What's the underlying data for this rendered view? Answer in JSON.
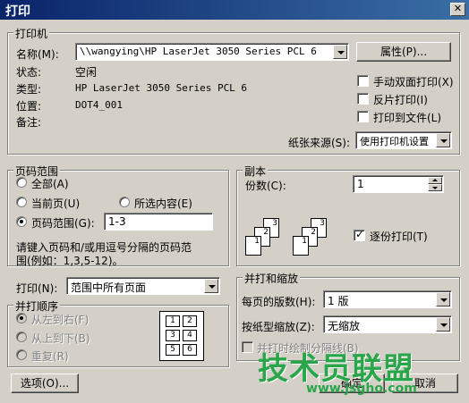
{
  "window": {
    "title": "打印",
    "close_glyph": "✕"
  },
  "printer": {
    "group_label": "打印机",
    "name_label": "名称(M):",
    "name_value": "\\\\wangying\\HP LaserJet 3050 Series PCL 6",
    "properties_button": "属性(P)...",
    "status_label": "状态:",
    "status_value": "空闲",
    "type_label": "类型:",
    "type_value": "HP LaserJet 3050 Series PCL 6",
    "location_label": "位置:",
    "location_value": "DOT4_001",
    "comment_label": "备注:",
    "comment_value": "",
    "manual_duplex": "手动双面打印(X)",
    "reverse_print": "反片打印(I)",
    "print_to_file": "打印到文件(L)",
    "paper_source_label": "纸张来源(S):",
    "paper_source_value": "使用打印机设置"
  },
  "page_range": {
    "group_label": "页码范围",
    "all": "全部(A)",
    "current": "当前页(U)",
    "selection": "所选内容(E)",
    "pages": "页码范围(G):",
    "pages_value": "1-3",
    "hint_line1": "请键入页码和/或用逗号分隔的页码范",
    "hint_line2": "围(例如：1,3,5-12)。"
  },
  "copies": {
    "group_label": "副本",
    "count_label": "份数(C):",
    "count_value": "1",
    "collate": "逐份打印(T)",
    "collate_checked": true,
    "page_icons": [
      "1",
      "2",
      "3"
    ]
  },
  "print_what": {
    "label": "打印(N):",
    "value": "范围中所有页面"
  },
  "print_order": {
    "group_label": "并打顺序",
    "left_to_right": "从左到右(F)",
    "top_to_bottom": "从上到下(B)",
    "repeat": "重复(R)",
    "preview_cells": [
      "1",
      "2",
      "3",
      "4",
      "5",
      "6"
    ]
  },
  "zoom": {
    "group_label": "并打和缩放",
    "pages_per_sheet_label": "每页的版数(H):",
    "pages_per_sheet_value": "1 版",
    "scale_label": "按纸型缩放(Z):",
    "scale_value": "无缩放",
    "draw_borders": "并打时绘制分隔线(B)"
  },
  "buttons": {
    "options": "选项(O)...",
    "ok": "确定",
    "cancel": "取消"
  },
  "watermark": {
    "text": "技术员联盟",
    "url": "www.jsgho.com"
  }
}
